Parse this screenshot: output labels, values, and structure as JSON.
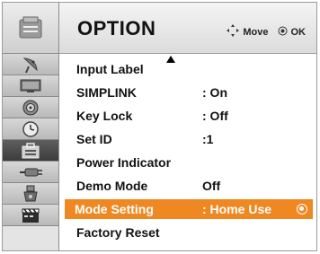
{
  "header": {
    "title": "OPTION",
    "hints": [
      {
        "icon": "four-way-arrows-icon",
        "label": "Move"
      },
      {
        "icon": "ok-button-icon",
        "label": "OK"
      }
    ]
  },
  "sidebar": {
    "categories": [
      {
        "icon": "setup-tab-icon"
      },
      {
        "icon": "satellite-dish-icon"
      },
      {
        "icon": "picture-screen-icon"
      },
      {
        "icon": "audio-speaker-icon"
      },
      {
        "icon": "clock-icon"
      },
      {
        "icon": "option-briefcase-icon",
        "active": true
      },
      {
        "icon": "input-plug-icon"
      },
      {
        "icon": "usb-stick-icon"
      },
      {
        "icon": "clapperboard-icon"
      }
    ]
  },
  "menu": {
    "items": [
      {
        "label": "Input Label",
        "value": ""
      },
      {
        "label": "SIMPLINK",
        "value": ": On"
      },
      {
        "label": "Key Lock",
        "value": ": Off"
      },
      {
        "label": "Set ID",
        "value": ":1"
      },
      {
        "label": "Power Indicator",
        "value": ""
      },
      {
        "label": "Demo Mode",
        "value": "Off"
      },
      {
        "label": "Mode Setting",
        "value": ": Home Use",
        "selected": true
      },
      {
        "label": "Factory Reset",
        "value": ""
      }
    ]
  }
}
